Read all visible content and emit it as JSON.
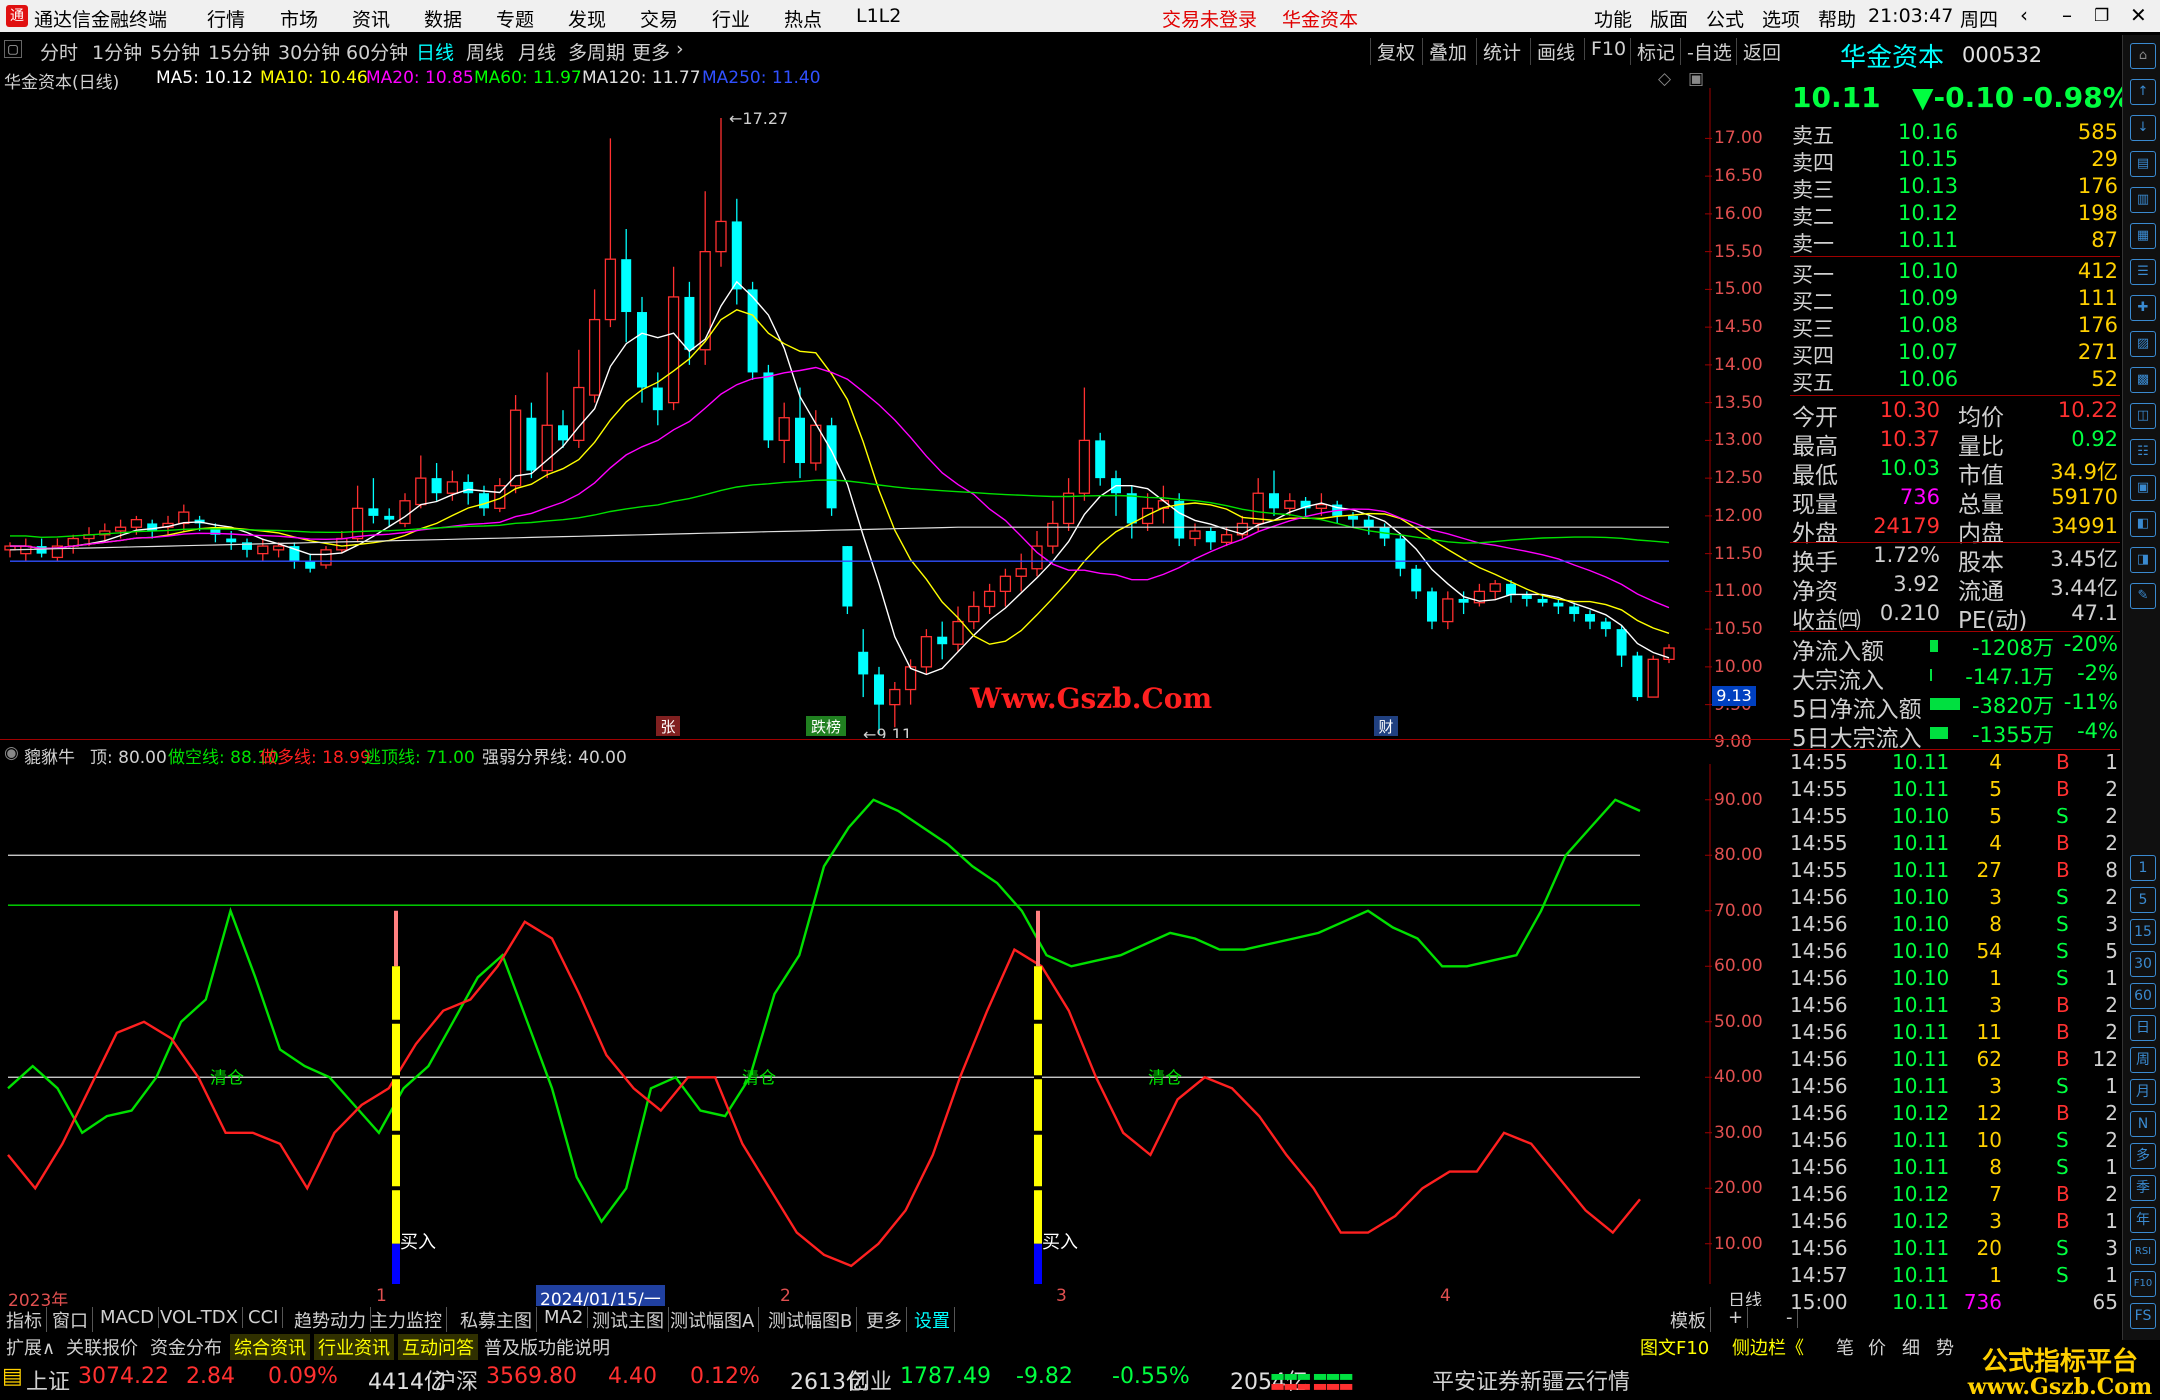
{
  "app": {
    "title": "通达信金融终端",
    "menu": [
      "行情",
      "市场",
      "资讯",
      "数据",
      "专题",
      "发现",
      "交易",
      "行业",
      "热点",
      "L1L2"
    ],
    "notice_trade": "交易未登录",
    "notice_broker": "华金资本",
    "right_menu": [
      "功能",
      "版面",
      "公式",
      "选项",
      "帮助"
    ],
    "clock": "21:03:47",
    "weekday": "周四"
  },
  "periods": [
    "分时",
    "1分钟",
    "5分钟",
    "15分钟",
    "30分钟",
    "60分钟",
    "日线",
    "周线",
    "月线",
    "多周期",
    "更多"
  ],
  "active_period": "日线",
  "tools": [
    "复权",
    "叠加",
    "统计",
    "画线",
    "F10",
    "标记",
    "-自选",
    "返回"
  ],
  "main_chart": {
    "title": "华金资本(日线)",
    "ma": [
      {
        "label": "MA5: 10.12",
        "color": "#ffffff"
      },
      {
        "label": "MA10: 10.46",
        "color": "#ffff00"
      },
      {
        "label": "MA20: 10.85",
        "color": "#ff00ff"
      },
      {
        "label": "MA60: 11.97",
        "color": "#00ff00"
      },
      {
        "label": "MA120: 11.77",
        "color": "#e0e0e0"
      },
      {
        "label": "MA250: 11.40",
        "color": "#3050ff"
      }
    ],
    "high_label": "17.27",
    "low_label": "9.11",
    "price_marker": "9.13",
    "axis": [
      "17.00",
      "16.50",
      "16.00",
      "15.50",
      "15.00",
      "14.50",
      "14.00",
      "13.50",
      "13.00",
      "12.50",
      "12.00",
      "11.50",
      "11.00",
      "10.50",
      "10.00",
      "9.50",
      "9.00"
    ],
    "tags": [
      "张",
      "跌榜",
      "财"
    ],
    "watermark": "Www.Gszb.Com",
    "candles": [
      [
        11.55,
        11.6,
        11.45,
        11.65
      ],
      [
        11.5,
        11.6,
        11.4,
        11.7
      ],
      [
        11.6,
        11.5,
        11.45,
        11.7
      ],
      [
        11.45,
        11.6,
        11.4,
        11.7
      ],
      [
        11.6,
        11.7,
        11.5,
        11.75
      ],
      [
        11.7,
        11.75,
        11.6,
        11.85
      ],
      [
        11.75,
        11.8,
        11.65,
        11.9
      ],
      [
        11.8,
        11.85,
        11.7,
        11.95
      ],
      [
        11.85,
        11.95,
        11.75,
        12.0
      ],
      [
        11.9,
        11.8,
        11.7,
        11.95
      ],
      [
        11.85,
        11.9,
        11.75,
        12.0
      ],
      [
        11.9,
        12.05,
        11.8,
        12.15
      ],
      [
        11.95,
        11.9,
        11.8,
        12.0
      ],
      [
        11.85,
        11.75,
        11.65,
        11.9
      ],
      [
        11.7,
        11.65,
        11.55,
        11.8
      ],
      [
        11.65,
        11.55,
        11.45,
        11.7
      ],
      [
        11.5,
        11.6,
        11.4,
        11.7
      ],
      [
        11.55,
        11.6,
        11.45,
        11.65
      ],
      [
        11.6,
        11.4,
        11.3,
        11.65
      ],
      [
        11.4,
        11.3,
        11.25,
        11.5
      ],
      [
        11.35,
        11.55,
        11.3,
        11.6
      ],
      [
        11.55,
        11.7,
        11.5,
        11.8
      ],
      [
        11.7,
        12.1,
        11.65,
        12.4
      ],
      [
        12.1,
        12.0,
        11.9,
        12.5
      ],
      [
        12.0,
        11.95,
        11.85,
        12.1
      ],
      [
        11.9,
        12.2,
        11.85,
        12.3
      ],
      [
        12.15,
        12.5,
        12.1,
        12.8
      ],
      [
        12.5,
        12.3,
        12.2,
        12.7
      ],
      [
        12.3,
        12.45,
        12.2,
        12.6
      ],
      [
        12.45,
        12.3,
        12.15,
        12.55
      ],
      [
        12.3,
        12.1,
        12.0,
        12.4
      ],
      [
        12.1,
        12.4,
        12.05,
        12.5
      ],
      [
        12.4,
        13.4,
        12.3,
        13.6
      ],
      [
        13.3,
        12.6,
        12.5,
        13.5
      ],
      [
        12.6,
        13.2,
        12.5,
        13.9
      ],
      [
        13.2,
        13.0,
        12.9,
        13.4
      ],
      [
        13.0,
        13.7,
        12.9,
        14.2
      ],
      [
        13.6,
        14.6,
        13.5,
        15.0
      ],
      [
        14.6,
        15.4,
        14.5,
        17.0
      ],
      [
        15.4,
        14.7,
        14.3,
        15.8
      ],
      [
        14.7,
        13.7,
        13.5,
        14.9
      ],
      [
        13.7,
        13.4,
        13.2,
        13.9
      ],
      [
        13.5,
        14.9,
        13.4,
        15.3
      ],
      [
        14.9,
        14.2,
        14.0,
        15.1
      ],
      [
        14.2,
        15.5,
        14.0,
        16.3
      ],
      [
        15.5,
        15.9,
        15.3,
        17.27
      ],
      [
        15.9,
        15.0,
        14.8,
        16.2
      ],
      [
        15.0,
        13.9,
        13.8,
        15.1
      ],
      [
        13.9,
        13.0,
        12.9,
        14.0
      ],
      [
        13.0,
        13.3,
        12.7,
        13.5
      ],
      [
        13.3,
        12.7,
        12.5,
        13.7
      ],
      [
        12.7,
        13.2,
        12.6,
        13.4
      ],
      [
        13.2,
        12.1,
        12.0,
        13.3
      ],
      [
        11.6,
        10.8,
        10.7,
        11.6
      ],
      [
        10.2,
        9.9,
        9.6,
        10.5
      ],
      [
        9.9,
        9.5,
        9.11,
        10.0
      ],
      [
        9.5,
        9.7,
        9.2,
        9.8
      ],
      [
        9.7,
        10.0,
        9.5,
        10.1
      ],
      [
        10.0,
        10.4,
        9.9,
        10.5
      ],
      [
        10.4,
        10.3,
        10.1,
        10.6
      ],
      [
        10.3,
        10.6,
        10.2,
        10.8
      ],
      [
        10.6,
        10.8,
        10.5,
        11.0
      ],
      [
        10.8,
        11.0,
        10.7,
        11.1
      ],
      [
        11.0,
        11.2,
        10.8,
        11.3
      ],
      [
        11.2,
        11.3,
        11.0,
        11.5
      ],
      [
        11.3,
        11.6,
        11.2,
        11.8
      ],
      [
        11.6,
        11.9,
        11.5,
        12.2
      ],
      [
        11.9,
        12.3,
        11.8,
        12.5
      ],
      [
        12.3,
        13.0,
        12.2,
        13.7
      ],
      [
        13.0,
        12.5,
        12.4,
        13.1
      ],
      [
        12.5,
        12.3,
        12.0,
        12.6
      ],
      [
        12.3,
        11.9,
        11.7,
        12.4
      ],
      [
        11.9,
        12.1,
        11.8,
        12.3
      ],
      [
        12.1,
        12.2,
        11.9,
        12.4
      ],
      [
        12.2,
        11.7,
        11.6,
        12.3
      ],
      [
        11.7,
        11.8,
        11.6,
        11.9
      ],
      [
        11.8,
        11.65,
        11.55,
        11.85
      ],
      [
        11.65,
        11.75,
        11.6,
        11.85
      ],
      [
        11.75,
        11.9,
        11.7,
        12.0
      ],
      [
        11.9,
        12.3,
        11.8,
        12.5
      ],
      [
        12.3,
        12.1,
        12.0,
        12.6
      ],
      [
        12.1,
        12.2,
        12.0,
        12.3
      ],
      [
        12.2,
        12.1,
        12.0,
        12.25
      ],
      [
        12.1,
        12.15,
        12.0,
        12.3
      ],
      [
        12.15,
        12.0,
        11.9,
        12.2
      ],
      [
        12.0,
        11.95,
        11.85,
        12.05
      ],
      [
        11.95,
        11.85,
        11.75,
        12.0
      ],
      [
        11.85,
        11.7,
        11.6,
        11.9
      ],
      [
        11.7,
        11.3,
        11.2,
        11.75
      ],
      [
        11.3,
        11.0,
        10.9,
        11.35
      ],
      [
        11.0,
        10.6,
        10.5,
        11.05
      ],
      [
        10.6,
        10.9,
        10.5,
        11.0
      ],
      [
        10.9,
        10.85,
        10.7,
        11.0
      ],
      [
        10.85,
        11.0,
        10.8,
        11.1
      ],
      [
        11.0,
        11.1,
        10.9,
        11.15
      ],
      [
        11.1,
        10.95,
        10.85,
        11.15
      ],
      [
        10.95,
        10.9,
        10.8,
        11.0
      ],
      [
        10.9,
        10.85,
        10.8,
        10.95
      ],
      [
        10.85,
        10.8,
        10.7,
        10.9
      ],
      [
        10.8,
        10.7,
        10.6,
        10.85
      ],
      [
        10.7,
        10.6,
        10.5,
        10.75
      ],
      [
        10.6,
        10.5,
        10.4,
        10.65
      ],
      [
        10.5,
        10.15,
        10.0,
        10.55
      ],
      [
        10.15,
        9.6,
        9.55,
        10.2
      ],
      [
        9.6,
        10.1,
        9.6,
        10.15
      ],
      [
        10.1,
        10.25,
        10.05,
        10.3
      ]
    ]
  },
  "indicator": {
    "name": "貔貅牛",
    "top_label": "顶: 80.00",
    "lines": [
      {
        "label": "做空线: 88.10",
        "color": "#00e000"
      },
      {
        "label": "做多线: 18.99",
        "color": "#ff2020"
      },
      {
        "label": "逃顶线: 71.00",
        "color": "#00e000"
      },
      {
        "label": "强弱分界线: 40.00",
        "color": "#d0d0d0"
      }
    ],
    "axis": [
      "90.00",
      "80.00",
      "70.00",
      "60.00",
      "50.00",
      "40.00",
      "30.00",
      "20.00",
      "10.00"
    ],
    "signal_clear": "清仓",
    "signal_buy": "买入",
    "green": [
      38,
      42,
      38,
      30,
      33,
      34,
      40,
      50,
      54,
      70,
      58,
      45,
      42,
      40,
      35,
      30,
      38,
      42,
      50,
      58,
      62,
      50,
      38,
      22,
      14,
      20,
      38,
      40,
      34,
      33,
      40,
      55,
      62,
      78,
      85,
      90,
      88,
      85,
      82,
      78,
      75,
      70,
      62,
      60,
      61,
      62,
      64,
      66,
      65,
      63,
      63,
      64,
      65,
      66,
      68,
      70,
      67,
      65,
      60,
      60,
      61,
      62,
      70,
      80,
      85,
      90,
      88
    ],
    "red": [
      26,
      20,
      28,
      38,
      48,
      50,
      47,
      40,
      30,
      30,
      28,
      20,
      30,
      35,
      38,
      46,
      52,
      54,
      60,
      68,
      65,
      55,
      44,
      38,
      34,
      40,
      40,
      28,
      20,
      12,
      8,
      6,
      10,
      16,
      26,
      40,
      52,
      63,
      60,
      52,
      40,
      30,
      26,
      36,
      40,
      38,
      33,
      26,
      20,
      12,
      12,
      15,
      20,
      23,
      23,
      30,
      28,
      22,
      16,
      12,
      18
    ]
  },
  "x_labels": [
    "2023年",
    "1",
    "2024/01/15/一",
    "2",
    "3",
    "4"
  ],
  "quote": {
    "name": "华金资本",
    "code": "000532",
    "price": "10.11",
    "change": "▼-0.10",
    "pct": "-0.98%",
    "asks": [
      [
        "卖五",
        "10.16",
        "585"
      ],
      [
        "卖四",
        "10.15",
        "29"
      ],
      [
        "卖三",
        "10.13",
        "176"
      ],
      [
        "卖二",
        "10.12",
        "198"
      ],
      [
        "卖一",
        "10.11",
        "87"
      ]
    ],
    "bids": [
      [
        "买一",
        "10.10",
        "412"
      ],
      [
        "买二",
        "10.09",
        "111"
      ],
      [
        "买三",
        "10.08",
        "176"
      ],
      [
        "买四",
        "10.07",
        "271"
      ],
      [
        "买五",
        "10.06",
        "52"
      ]
    ],
    "stats": [
      [
        "今开",
        "10.30",
        "均价",
        "10.22"
      ],
      [
        "最高",
        "10.37",
        "量比",
        "0.92"
      ],
      [
        "最低",
        "10.03",
        "市值",
        "34.9亿"
      ],
      [
        "现量",
        "736",
        "总量",
        "59170"
      ],
      [
        "外盘",
        "24179",
        "内盘",
        "34991"
      ],
      [
        "换手",
        "1.72%",
        "股本",
        "3.45亿"
      ],
      [
        "净资",
        "3.92",
        "流通",
        "3.44亿"
      ],
      [
        "收益㈣",
        "0.210",
        "PE(动)",
        "47.1"
      ]
    ],
    "flows": [
      [
        "净流入额",
        "-1208万",
        "-20%"
      ],
      [
        "大宗流入",
        "-147.1万",
        "-2%"
      ],
      [
        "5日净流入额",
        "-3820万",
        "-11%"
      ],
      [
        "5日大宗流入",
        "-1355万",
        "-4%"
      ]
    ],
    "ticks": [
      [
        "14:55",
        "10.11",
        "4",
        "B",
        "1"
      ],
      [
        "14:55",
        "10.11",
        "5",
        "B",
        "2"
      ],
      [
        "14:55",
        "10.10",
        "5",
        "S",
        "2"
      ],
      [
        "14:55",
        "10.11",
        "4",
        "B",
        "2"
      ],
      [
        "14:55",
        "10.11",
        "27",
        "B",
        "8"
      ],
      [
        "14:56",
        "10.10",
        "3",
        "S",
        "2"
      ],
      [
        "14:56",
        "10.10",
        "8",
        "S",
        "3"
      ],
      [
        "14:56",
        "10.10",
        "54",
        "S",
        "5"
      ],
      [
        "14:56",
        "10.10",
        "1",
        "S",
        "1"
      ],
      [
        "14:56",
        "10.11",
        "3",
        "B",
        "2"
      ],
      [
        "14:56",
        "10.11",
        "11",
        "B",
        "2"
      ],
      [
        "14:56",
        "10.11",
        "62",
        "B",
        "12"
      ],
      [
        "14:56",
        "10.11",
        "3",
        "S",
        "1"
      ],
      [
        "14:56",
        "10.12",
        "12",
        "B",
        "2"
      ],
      [
        "14:56",
        "10.11",
        "10",
        "S",
        "2"
      ],
      [
        "14:56",
        "10.11",
        "8",
        "S",
        "1"
      ],
      [
        "14:56",
        "10.12",
        "7",
        "B",
        "2"
      ],
      [
        "14:56",
        "10.12",
        "3",
        "B",
        "1"
      ],
      [
        "14:56",
        "10.11",
        "20",
        "S",
        "3"
      ],
      [
        "14:57",
        "10.11",
        "1",
        "S",
        "1"
      ],
      [
        "15:00",
        "10.11",
        "736",
        "",
        "65"
      ]
    ]
  },
  "side_icons": [
    "1",
    "5",
    "15",
    "30",
    "60",
    "日",
    "周",
    "月",
    "N",
    "多",
    "季",
    "年",
    "RSI",
    "F10",
    "FS"
  ],
  "bottom_tabs": [
    "指标",
    "窗口",
    "MACD",
    "VOL-TDX",
    "CCI",
    "趋势动力",
    "主力监控",
    "私募主图",
    "MA2",
    "测试主图",
    "测试幅图A",
    "测试幅图B",
    "更多",
    "设置"
  ],
  "bottom_tabs_right": [
    "模板",
    "+",
    "-"
  ],
  "info_tabs": [
    "扩展∧",
    "关联报价",
    "资金分布",
    "综合资讯",
    "行业资讯",
    "互动问答",
    "普及版功能说明"
  ],
  "info_tabs_right": [
    "图文F10",
    "侧边栏《",
    "笔",
    "价",
    "细",
    "势"
  ],
  "period_tag": "日线",
  "ticker": {
    "sh": [
      "上证",
      "3074.22",
      "2.84",
      "0.09%",
      "4414亿"
    ],
    "sz": [
      "沪深",
      "3569.80",
      "4.40",
      "0.12%",
      "2613亿"
    ],
    "cy": [
      "创业",
      "1787.49",
      "-9.82",
      "-0.55%",
      "2054亿"
    ],
    "server": "平安证券新疆云行情"
  },
  "brand": {
    "line1": "公式指标平台",
    "line2": "www.Gszb.Com"
  }
}
